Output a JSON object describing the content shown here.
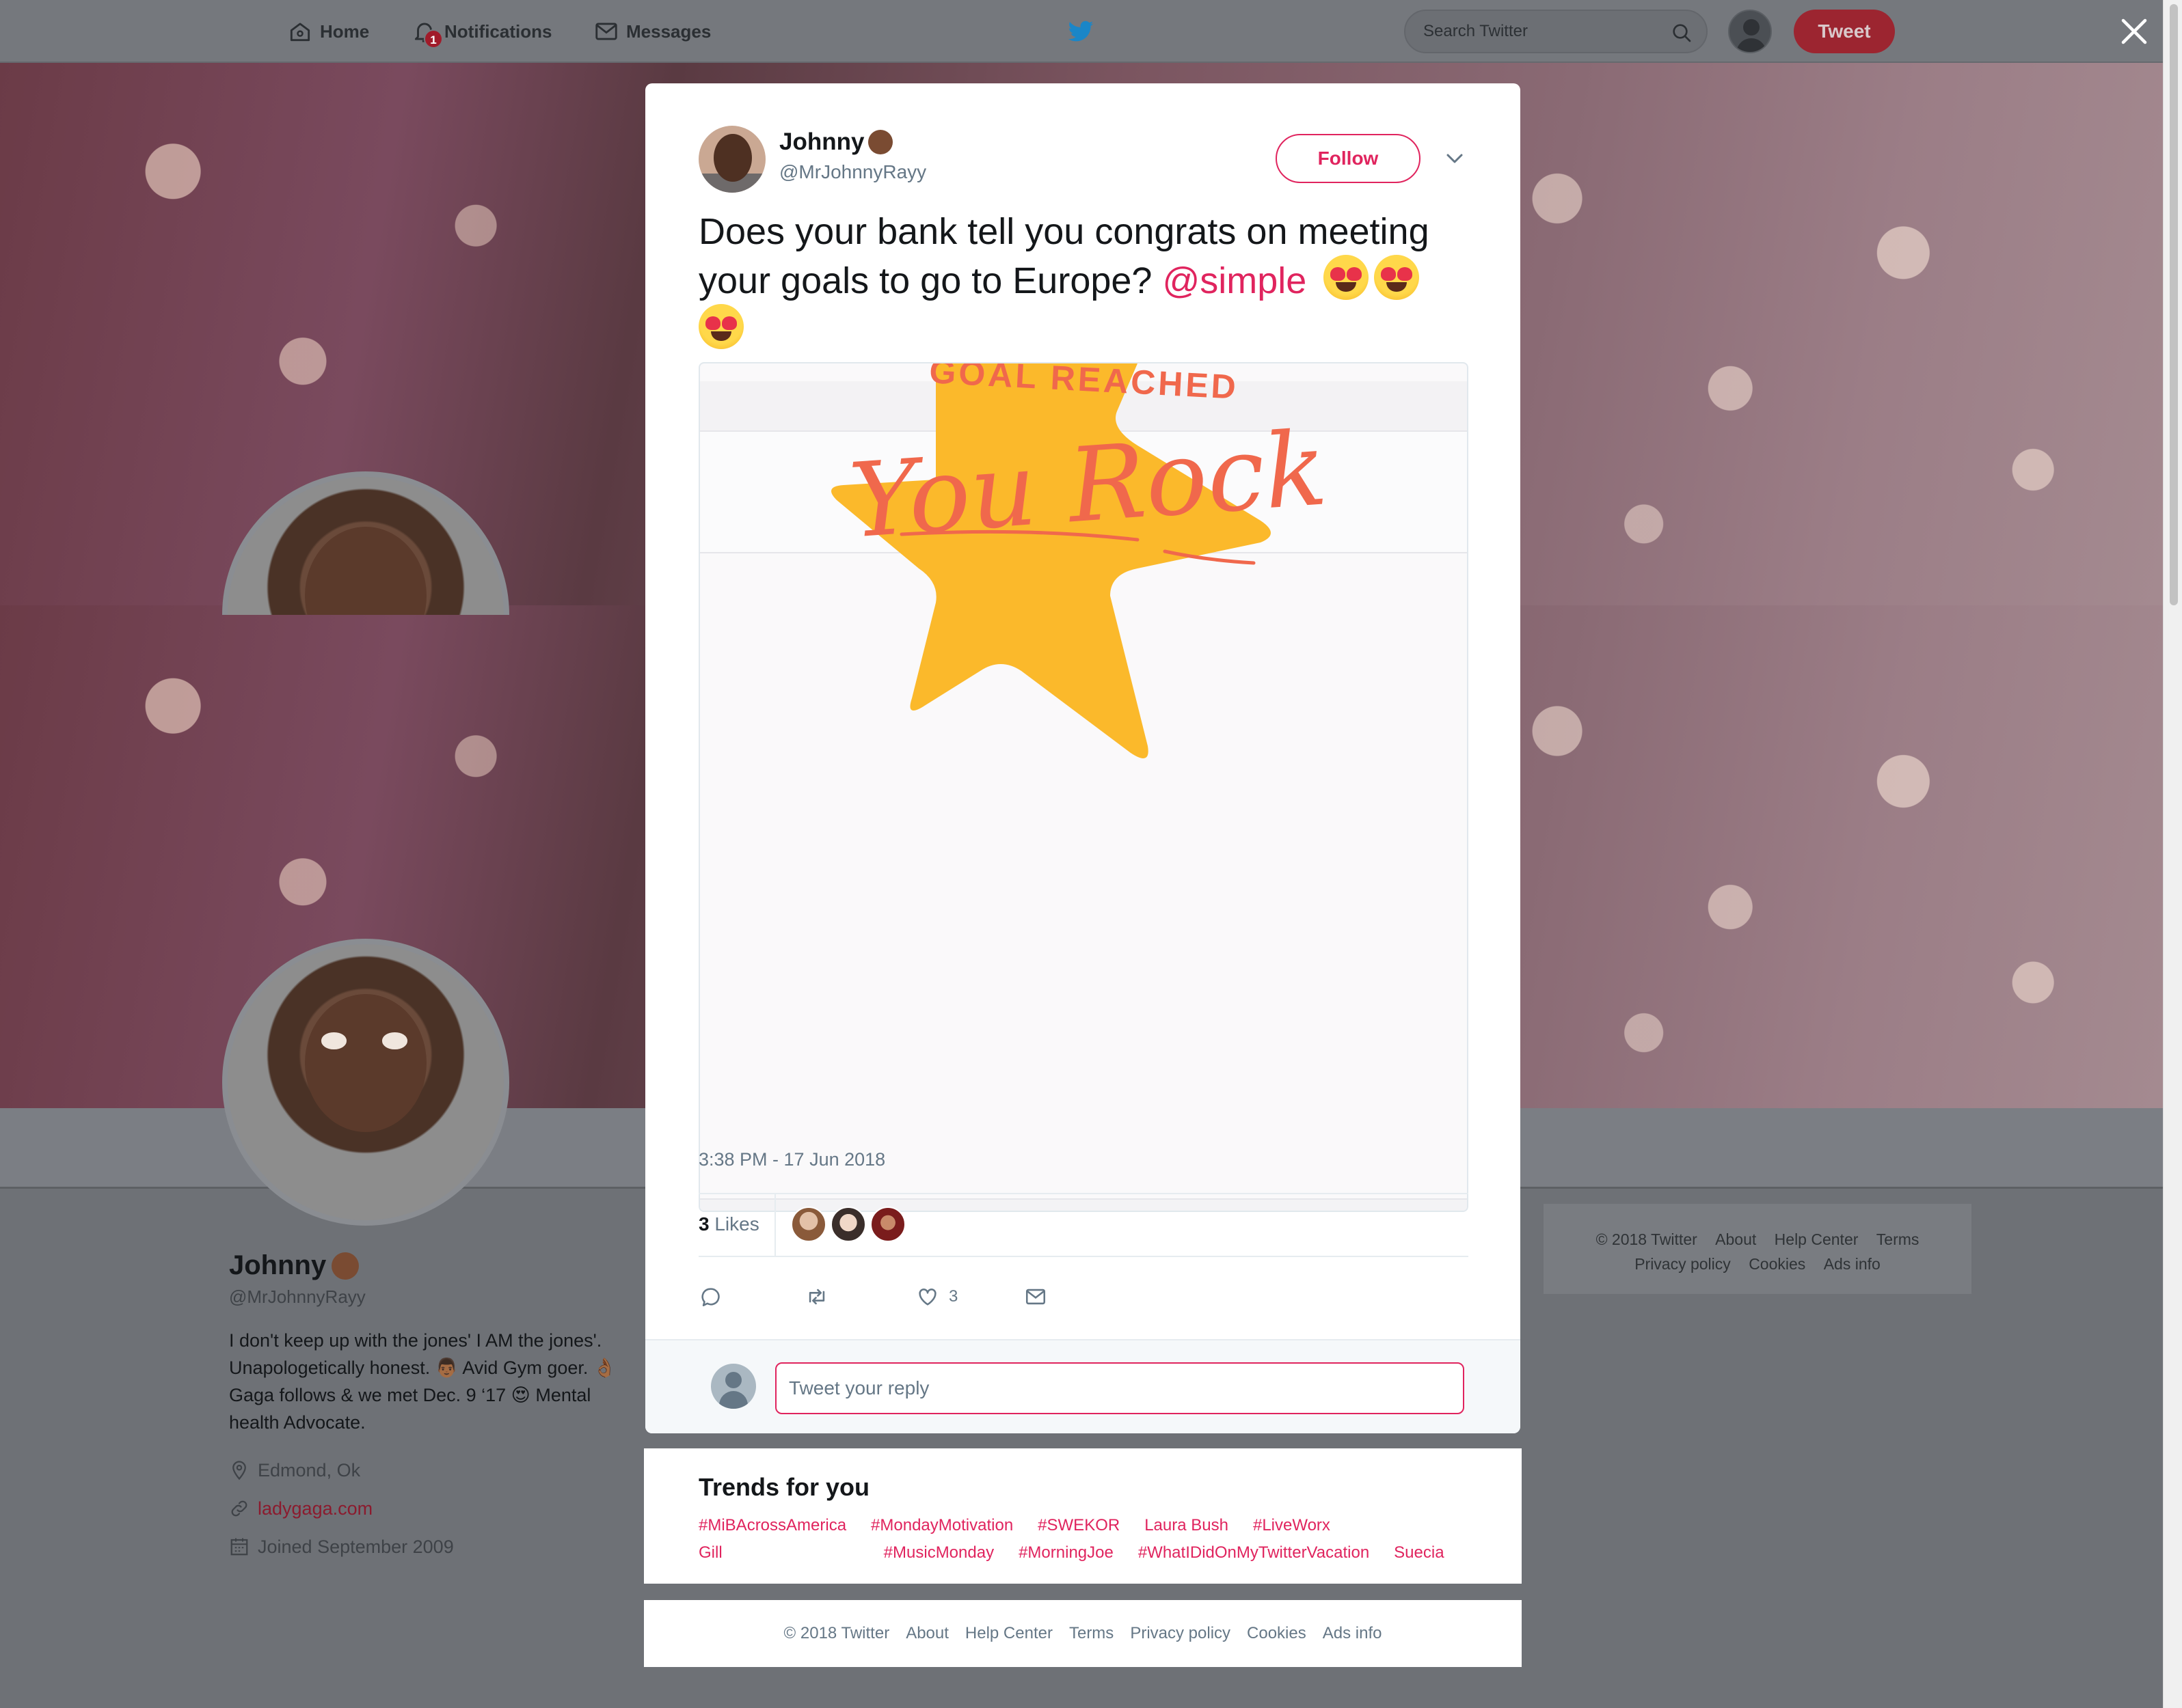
{
  "topnav": {
    "home": "Home",
    "notifications": "Notifications",
    "notifications_badge": "1",
    "messages": "Messages",
    "search_placeholder": "Search Twitter",
    "tweet_button": "Tweet"
  },
  "profile": {
    "name": "Johnny",
    "handle": "@MrJohnnyRayy",
    "bio": "I don't keep up with the jones' I AM the jones'. Unapologetically honest. 👨🏾 Avid Gym goer. 👌🏾 Gaga follows & we met Dec. 9 ‘17 😍 Mental health Advocate.",
    "location": "Edmond, Ok",
    "website": "ladygaga.com",
    "joined": "Joined September 2009"
  },
  "right_footer": {
    "row1": [
      "© 2018 Twitter",
      "About",
      "Help Center",
      "Terms"
    ],
    "row2": [
      "Privacy policy",
      "Cookies",
      "Ads info"
    ]
  },
  "tweet": {
    "author_name": "Johnny",
    "author_handle": "@MrJohnnyRayy",
    "follow_label": "Follow",
    "text_main": "Does your bank tell you congrats on meeting your goals to go to Europe? ",
    "mention": "@simple",
    "media_top_text": "GOAL REACHED",
    "media_script_text": "You Rock",
    "timestamp": "3:38 PM - 17 Jun 2018",
    "likes_number": "3",
    "likes_word": "Likes",
    "like_action_count": "3",
    "reply_placeholder": "Tweet your reply"
  },
  "trends": {
    "title": "Trends for you",
    "items": [
      "#MiBAcrossAmerica",
      "#MondayMotivation",
      "#SWEKOR",
      "Laura Bush",
      "#LiveWorx",
      "Gill",
      "#MusicMonday",
      "#MorningJoe",
      "#WhatIDidOnMyTwitterVacation",
      "Suecia"
    ]
  },
  "footer": {
    "links": [
      "© 2018 Twitter",
      "About",
      "Help Center",
      "Terms",
      "Privacy policy",
      "Cookies",
      "Ads info"
    ]
  },
  "colors": {
    "accent": "#e0245e",
    "twitter_blue": "#1da1f2",
    "star": "#fbb92b",
    "script": "#f0684c"
  },
  "icons": [
    "home-icon",
    "bell-icon",
    "envelope-icon",
    "twitter-bird-icon",
    "search-icon",
    "close-icon",
    "chevron-down-icon",
    "reply-icon",
    "retweet-icon",
    "heart-icon",
    "dm-icon",
    "location-icon",
    "link-icon",
    "calendar-icon"
  ]
}
